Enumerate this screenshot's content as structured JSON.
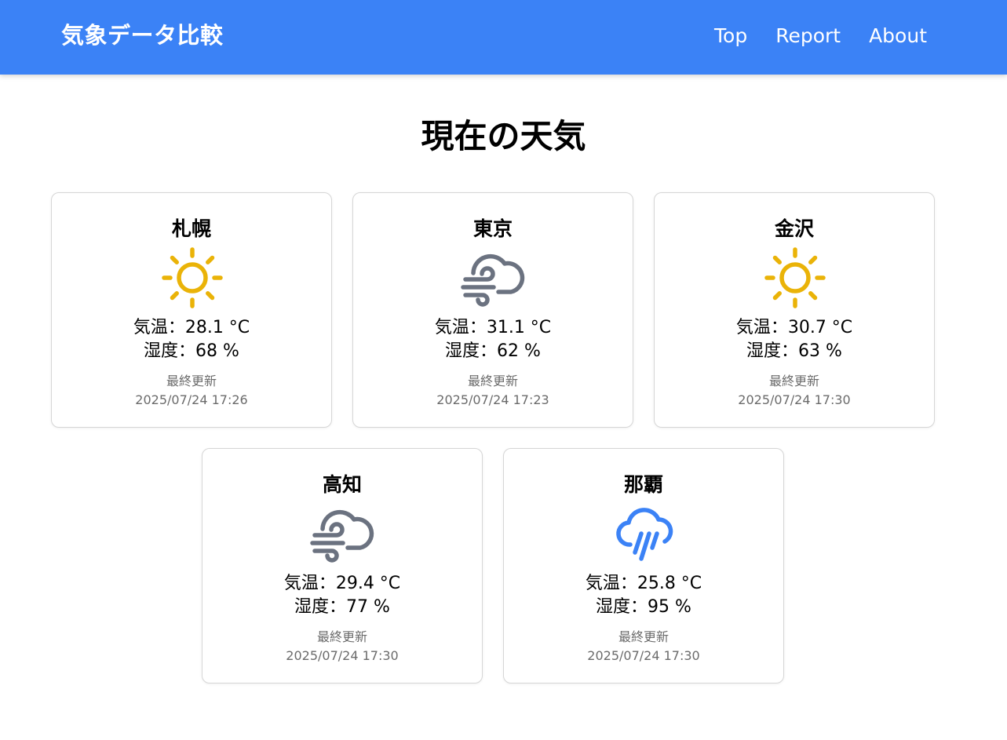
{
  "header": {
    "brand": "気象データ比較",
    "nav": [
      {
        "label": "Top"
      },
      {
        "label": "Report"
      },
      {
        "label": "About"
      }
    ]
  },
  "main": {
    "title": "現在の天気",
    "cards": [
      {
        "city": "札幌",
        "icon": "sun-icon",
        "temp": "気温：28.1 °C",
        "humidity": "湿度：68 %",
        "updated_label": "最終更新",
        "updated_time": "2025/07/24 17:26"
      },
      {
        "city": "東京",
        "icon": "wind-cloud-icon",
        "temp": "気温：31.1 °C",
        "humidity": "湿度：62 %",
        "updated_label": "最終更新",
        "updated_time": "2025/07/24 17:23"
      },
      {
        "city": "金沢",
        "icon": "sun-icon",
        "temp": "気温：30.7 °C",
        "humidity": "湿度：63 %",
        "updated_label": "最終更新",
        "updated_time": "2025/07/24 17:30"
      },
      {
        "city": "高知",
        "icon": "wind-cloud-icon",
        "temp": "気温：29.4 °C",
        "humidity": "湿度：77 %",
        "updated_label": "最終更新",
        "updated_time": "2025/07/24 17:30"
      },
      {
        "city": "那覇",
        "icon": "rain-cloud-icon",
        "temp": "気温：25.8 °C",
        "humidity": "湿度：95 %",
        "updated_label": "最終更新",
        "updated_time": "2025/07/24 17:30"
      }
    ]
  },
  "colors": {
    "header_bg": "#3b82f6",
    "sun": "#eab308",
    "wind_cloud": "#6b7280",
    "rain_cloud": "#3b82f6"
  }
}
